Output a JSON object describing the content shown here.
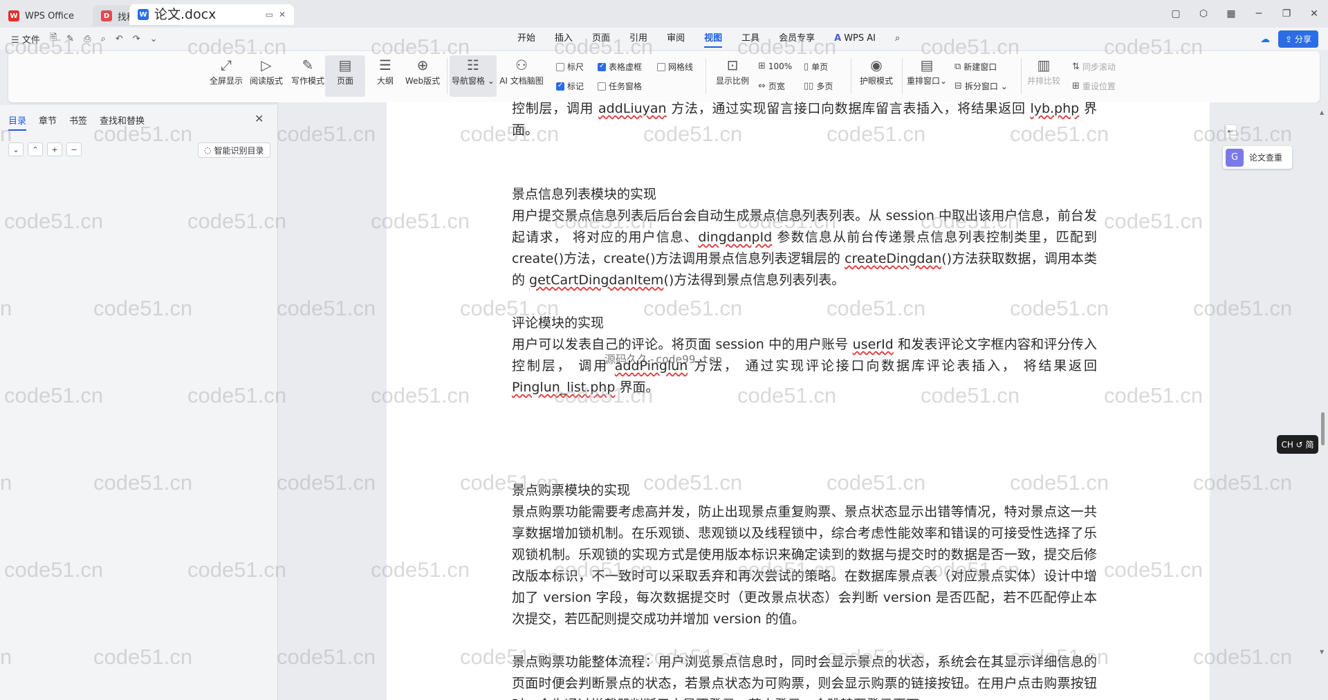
{
  "titlebar": {
    "tabs": [
      {
        "label": "WPS Office"
      },
      {
        "label": "找稻壳模板"
      },
      {
        "label": "论文.docx"
      }
    ]
  },
  "menubar": {
    "file_label": "文件",
    "tabs": [
      "开始",
      "插入",
      "页面",
      "引用",
      "审阅",
      "视图",
      "工具",
      "会员专享"
    ],
    "active_tab": "视图",
    "ai_label": "WPS AI",
    "share_label": "分享"
  },
  "ribbon": {
    "big_buttons": [
      "全屏显示",
      "阅读版式",
      "写作模式",
      "页面",
      "大纲",
      "Web版式",
      "导航窗格",
      "AI 文档脑图"
    ],
    "checks": [
      {
        "label": "标尺",
        "checked": false
      },
      {
        "label": "表格虚框",
        "checked": true
      },
      {
        "label": "网格线",
        "checked": false
      },
      {
        "label": "标记",
        "checked": true
      },
      {
        "label": "任务窗格",
        "checked": false
      }
    ],
    "zoom": {
      "display_ratio": "显示比例",
      "percent": "100%",
      "page_width": "页宽",
      "single_page": "单页",
      "multi_page": "多页"
    },
    "eye_mode": "护眼模式",
    "window": {
      "rearrange": "重排窗口",
      "new_window": "新建窗口",
      "split_window": "拆分窗口"
    },
    "compare": {
      "side_by_side": "并排比较",
      "sync_scroll": "同步滚动",
      "reset_position": "重设位置"
    }
  },
  "left_panel": {
    "tabs": [
      "目录",
      "章节",
      "书签",
      "查找和替换"
    ],
    "smart_toc": "智能识别目录"
  },
  "document": {
    "para0": {
      "a": "控制层，调用 ",
      "u1": "addLiuyan",
      "b": " 方法，通过实现留言接口向数据库留言表插入，将结果返回 ",
      "u2": "lyb.php",
      "c": " 界面。"
    },
    "h1": "景点信息列表模块的实现",
    "para1": {
      "a": "用户提交景点信息列表后后台会自动生成景点信息列表列表。从 session 中取出该用户信息，前台发起请求， 将对应的用户信息、",
      "u1": "dingdanpId",
      "b": " 参数信息从前台传递景点信息列表控制类里，匹配到 create()方法，create()方法调用景点信息列表逻辑层的 ",
      "u2": "createDingdan",
      "c": "()方法获取数据，调用本类的 ",
      "u3": "getCartDingdanItem",
      "d": "()方法得到景点信息列表列表。"
    },
    "h2": "评论模块的实现",
    "para2": {
      "a": "用户可以发表自己的评论。将页面 session 中的用户账号 ",
      "u1": "userId",
      "b": " 和发表评论文字框内容和评分传入控制层， 调用 ",
      "u2": "addPinglun",
      "c": " 方法， 通过实现评论接口向数据库评论表插入， 将结果返回 ",
      "u3": "Pinglun_list.php",
      "d": " 界面。"
    },
    "h3": "景点购票模块的实现",
    "para3": "景点购票功能需要考虑高并发，防止出现景点重复购票、景点状态显示出错等情况，特对景点这一共享数据增加锁机制。在乐观锁、悲观锁以及线程锁中，综合考虑性能效率和错误的可接受性选择了乐观锁机制。乐观锁的实现方式是使用版本标识来确定读到的数据与提交时的数据是否一致，提交后修改版本标识，不一致时可以采取丢弃和再次尝试的策略。在数据库景点表（对应景点实体）设计中增加了 version 字段，每次数据提交时（更改景点状态）会判断 version 是否匹配，若不匹配停止本次提交，若匹配则提交成功并增加 version 的值。",
    "para4": "景点购票功能整体流程：用户浏览景点信息时，同时会显示景点的状态，系统会在其显示详细信息的页面时便会判断景点的状态，若景点状态为可购票，则会显示购票的链接按钮。在用户点击购票按钮时，会先通过拦截器判断用户是否登录，若未登录，会跳转至登录页面。"
  },
  "watermark": {
    "text": "code51.cn",
    "center_text": "源码久久-code99.top"
  },
  "side": {
    "paper_check": "论文查重",
    "ime": "CH ↺ 简"
  }
}
